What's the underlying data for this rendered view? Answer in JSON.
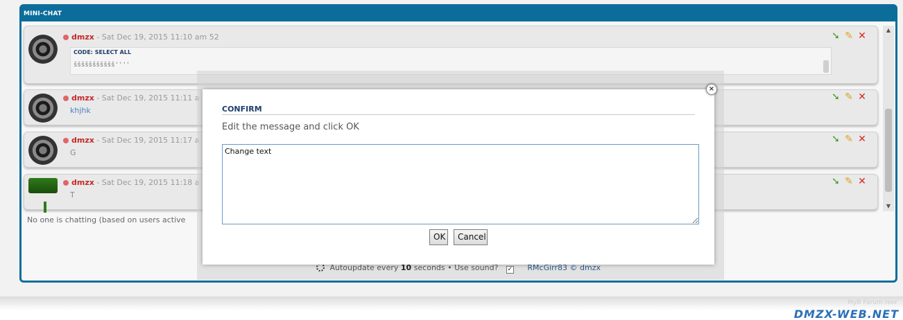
{
  "panel": {
    "title": "MINI-CHAT"
  },
  "messages": [
    {
      "user": "dmzx",
      "timestamp": "- Sat Dec 19, 2015 11:10 am 52",
      "code_label": "CODE: SELECT ALL",
      "code_text": "ššššššššššš''''",
      "avatar": "speaker-avatar"
    },
    {
      "user": "dmzx",
      "timestamp": "- Sat Dec 19, 2015 11:11 a",
      "text": "khjhk",
      "avatar": "speaker-avatar"
    },
    {
      "user": "dmzx",
      "timestamp": "- Sat Dec 19, 2015 11:17 a",
      "text": "G",
      "avatar": "speaker-avatar"
    },
    {
      "user": "dmzx",
      "timestamp": "- Sat Dec 19, 2015 11:18 a",
      "text": "T",
      "avatar": "green-avatar"
    }
  ],
  "status_line": "No one is chatting (based on users active",
  "footer": {
    "autoupdate_prefix": "Autoupdate every",
    "autoupdate_seconds": "10",
    "autoupdate_suffix": "seconds • Use sound?",
    "sound_checked": true,
    "credit": "RMcGirr83 © dmzx"
  },
  "dialog": {
    "title": "CONFIRM",
    "description": "Edit the message and click OK",
    "textarea_value": "Change text",
    "ok_label": "OK",
    "cancel_label": "Cancel"
  },
  "watermark": {
    "small": "MyB Forum reer",
    "brand": "DMZX-WEB.NET"
  },
  "colors": {
    "frame": "#0c6d9b",
    "username": "#c62828",
    "dialog_title": "#1d3d6b",
    "brand": "#2b6fb8"
  }
}
